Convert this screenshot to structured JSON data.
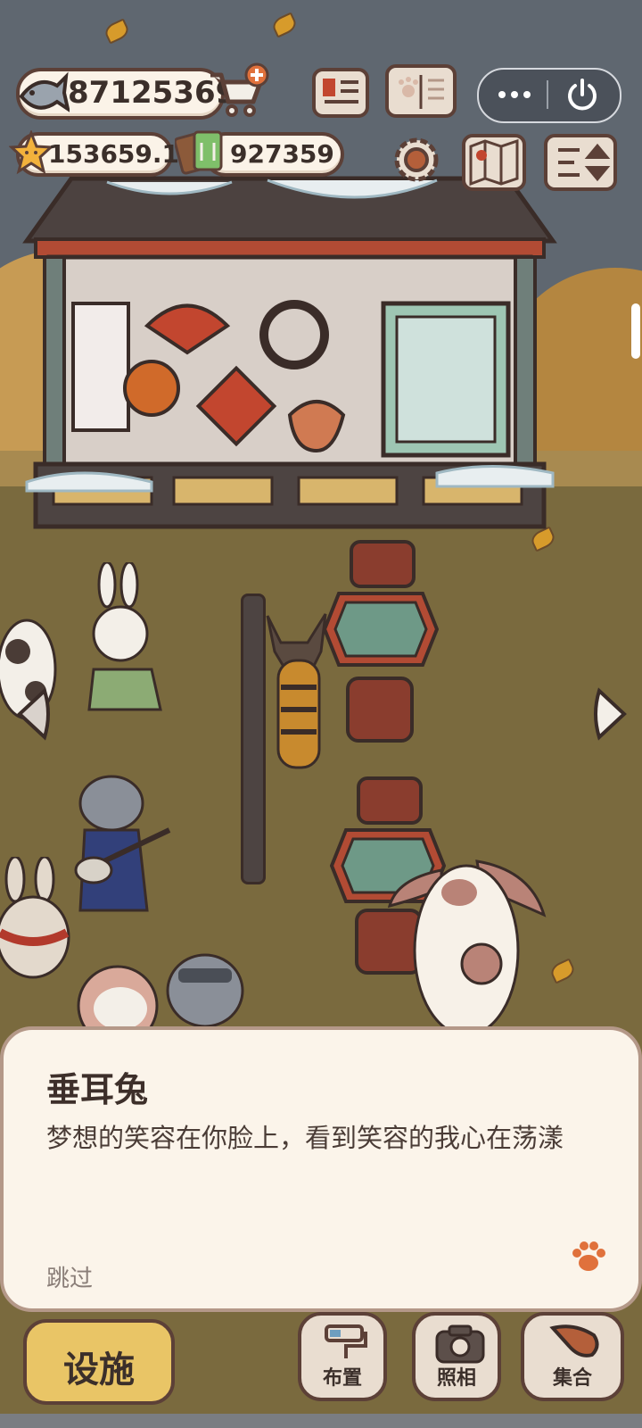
{
  "hud": {
    "fish_count": "87125369",
    "star_count": "153659.1",
    "ticket_count": "927359"
  },
  "icons": {
    "fish": "fish-icon",
    "cart": "shopping-cart-plus-icon",
    "star": "star-icon",
    "ticket": "ticket-icon",
    "newspaper": "newspaper-icon",
    "pawbook": "paw-book-icon",
    "settings": "gear-icon",
    "map": "map-icon",
    "sort": "sort-icon",
    "more": "more-dots-icon",
    "power": "power-icon",
    "left": "chevron-left-icon",
    "right": "chevron-right-icon",
    "paw": "paw-icon"
  },
  "dialog": {
    "speaker": "垂耳兔",
    "text": "梦想的笑容在你脸上，看到笑容的我心在荡漾",
    "skip": "跳过"
  },
  "bottom": {
    "facilities": "设施",
    "arrange": "布置",
    "photo": "照相",
    "gather": "集合"
  },
  "colors": {
    "outline": "#5c4037",
    "panel": "#fbf4ea",
    "ground": "#7a6a3e",
    "accent_orange": "#e0713c",
    "facilities_yellow": "#e9c566"
  }
}
